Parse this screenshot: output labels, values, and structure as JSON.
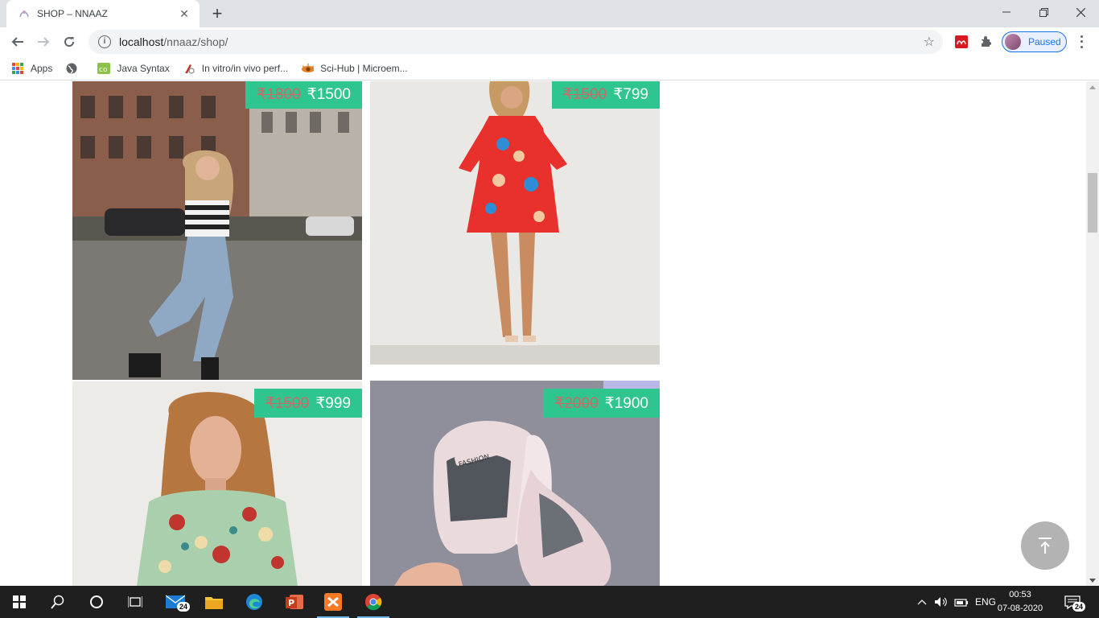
{
  "browser": {
    "tab_title": "SHOP – NNAAZ",
    "url_host": "localhost",
    "url_path": "/nnaaz/shop/",
    "profile_status": "Paused"
  },
  "bookmarks": [
    {
      "label": "Apps"
    },
    {
      "label": "Java Syntax"
    },
    {
      "label": "In vitro/in vivo perf..."
    },
    {
      "label": "Sci-Hub | Microem..."
    }
  ],
  "products": [
    {
      "old_price": "₹1800",
      "new_price": "₹1500",
      "image": "woman-striped-top-ripped-jeans-street"
    },
    {
      "old_price": "₹1500",
      "new_price": "₹799",
      "image": "woman-red-floral-dress"
    },
    {
      "old_price": "₹1500",
      "new_price": "₹999",
      "image": "woman-green-floral-top"
    },
    {
      "old_price": "₹2000",
      "new_price": "₹1900",
      "image": "pink-fashion-sneakers"
    }
  ],
  "colors": {
    "price_tag": "#2ec58e",
    "old_price": "#c86b6b",
    "scroll_top_button": "#b3b3b3"
  },
  "taskbar": {
    "mail_badge": "24",
    "language": "ENG",
    "time": "00:53",
    "date": "07-08-2020",
    "notification_count": "24"
  }
}
